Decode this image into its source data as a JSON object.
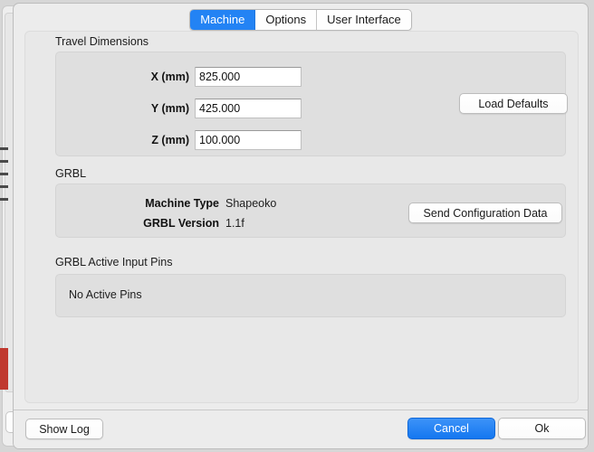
{
  "window": {
    "tabs": [
      {
        "label": "Machine",
        "active": true
      },
      {
        "label": "Options",
        "active": false
      },
      {
        "label": "User Interface",
        "active": false
      }
    ]
  },
  "travel_dimensions": {
    "title": "Travel Dimensions",
    "fields": [
      {
        "label": "X (mm)",
        "value": "825.000"
      },
      {
        "label": "Y (mm)",
        "value": "425.000"
      },
      {
        "label": "Z (mm)",
        "value": "100.000"
      }
    ],
    "load_defaults_label": "Load Defaults"
  },
  "grbl": {
    "title": "GRBL",
    "rows": [
      {
        "label": "Machine Type",
        "value": "Shapeoko"
      },
      {
        "label": "GRBL Version",
        "value": "1.1f"
      }
    ],
    "send_config_label": "Send Configuration Data"
  },
  "active_pins": {
    "title": "GRBL Active Input Pins",
    "status": "No Active Pins"
  },
  "footer": {
    "show_log_label": "Show Log",
    "cancel_label": "Cancel",
    "ok_label": "Ok"
  },
  "colors": {
    "accent_blue": "#2383f4",
    "dialog_bg": "#ececec",
    "panel_bg": "#dfdfdf",
    "backdrop_red": "#c0392f"
  }
}
